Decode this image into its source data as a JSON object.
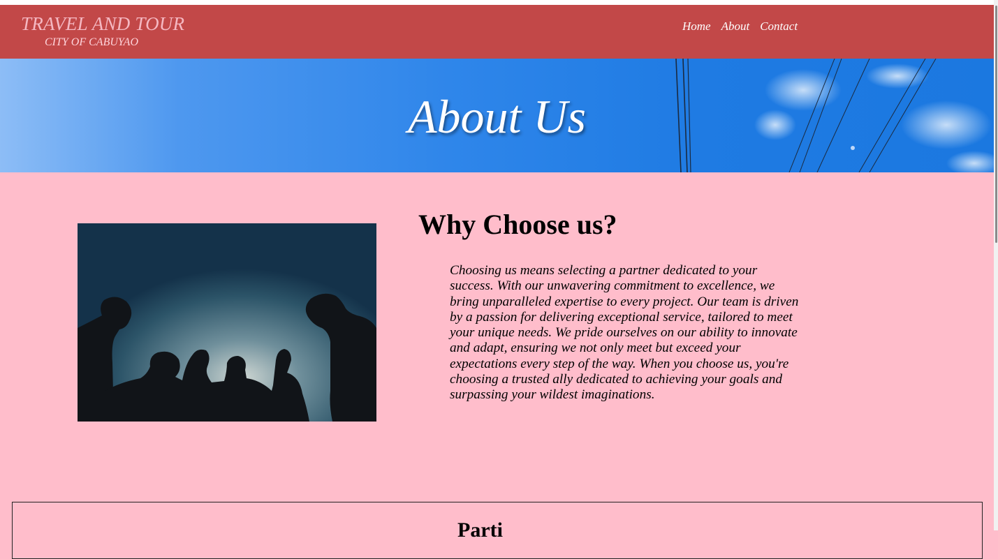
{
  "header": {
    "brand_title": "TRAVEL AND TOUR",
    "brand_subtitle": "CITY OF CABUYAO",
    "nav": [
      "Home",
      "About",
      "Contact"
    ]
  },
  "hero": {
    "title": "About Us"
  },
  "why_section": {
    "heading": "Why Choose us?",
    "body": "Choosing us means selecting a partner dedicated to your success. With our unwavering commitment to excellence, we bring unparalleled expertise to every project. Our team is driven by a passion for delivering exceptional service, tailored to meet your unique needs. We pride ourselves on our ability to innovate and adapt, ensuring we not only meet but exceed your expectations every step of the way. When you choose us, you're choosing a trusted ally dedicated to achieving your goals and surpassing your wildest imaginations."
  },
  "next_section": {
    "heading": "Parti"
  },
  "colors": {
    "header_bg": "#c24848",
    "page_bg": "#ffbdcb",
    "hero_blue": "#1f7be3"
  },
  "icons": {
    "team_photo": "silhouettes-at-dusk-image",
    "hero_image": "blue-sky-with-power-lines-image"
  }
}
